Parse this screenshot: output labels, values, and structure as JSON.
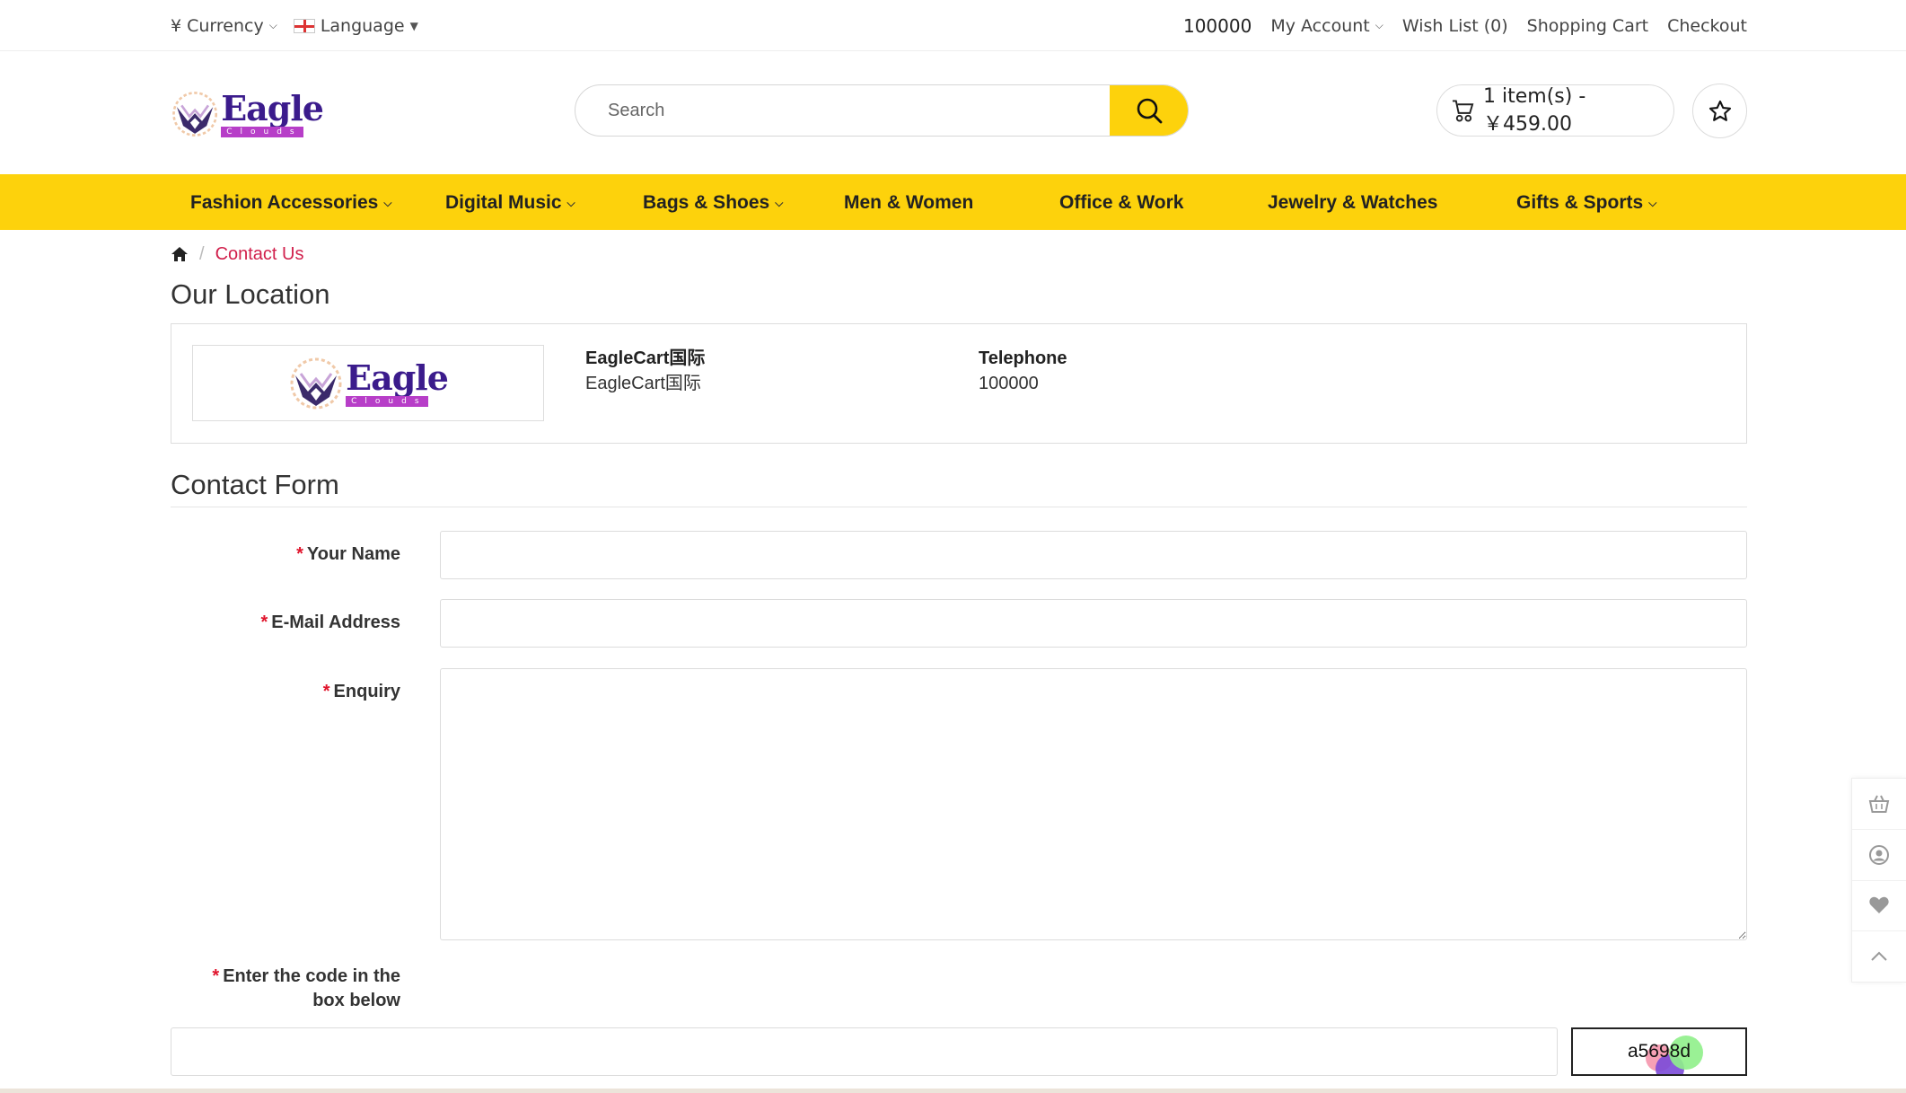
{
  "topbar": {
    "currency_symbol": "¥",
    "currency_label": "Currency",
    "language_label": "Language",
    "phone": "100000",
    "my_account": "My Account",
    "wish_list": "Wish List (0)",
    "shopping_cart": "Shopping Cart",
    "checkout": "Checkout"
  },
  "header": {
    "logo_word": "Eagle",
    "logo_sub": "Clouds",
    "search_placeholder": "Search",
    "cart_label": "1 item(s) - ￥459.00"
  },
  "nav": {
    "items": [
      {
        "label": "Fashion Accessories",
        "has_dropdown": true
      },
      {
        "label": "Digital Music",
        "has_dropdown": true
      },
      {
        "label": "Bags & Shoes",
        "has_dropdown": true
      },
      {
        "label": "Men & Women",
        "has_dropdown": false
      },
      {
        "label": "Office & Work",
        "has_dropdown": false
      },
      {
        "label": "Jewelry & Watches",
        "has_dropdown": false
      },
      {
        "label": "Gifts & Sports",
        "has_dropdown": true
      }
    ]
  },
  "breadcrumb": {
    "current": "Contact Us"
  },
  "location": {
    "title": "Our Location",
    "store_name": "EagleCart国际",
    "store_address": "EagleCart国际",
    "telephone_label": "Telephone",
    "telephone_value": "100000"
  },
  "form": {
    "title": "Contact Form",
    "name_label": "Your Name",
    "email_label": "E-Mail Address",
    "enquiry_label": "Enquiry",
    "captcha_label_line1": "Enter the code in the",
    "captcha_label_line2": "box below",
    "captcha_code": "a5698d"
  },
  "colors": {
    "accent_yellow": "#fdd20c",
    "breadcrumb_red": "#d1204c",
    "required_red": "#e0142c"
  },
  "icons": {
    "cart": "cart-icon",
    "wishlist": "star-icon",
    "search": "search-icon",
    "home": "home-icon",
    "side": [
      "basket-icon",
      "user-icon",
      "heart-icon",
      "chevron-up-icon"
    ]
  }
}
